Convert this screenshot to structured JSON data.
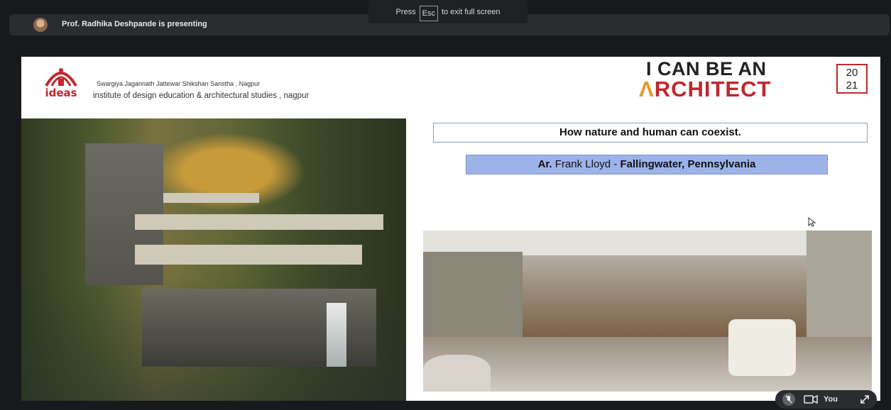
{
  "presenter_bar": {
    "text": "Prof. Radhika Deshpande is presenting"
  },
  "fullscreen_toast": {
    "before": "Press",
    "key": "Esc",
    "after": "to exit full screen"
  },
  "slide": {
    "logo_word": "ideas",
    "institute_line1": "Swargiya Jagannath Jattewar Shikshan Sanstha , Nagpur",
    "institute_line2": "institute of design education & architectural studies , nagpur",
    "campaign_line1": "I CAN BE AN",
    "campaign_line2_mark": "Λ",
    "campaign_line2_rest": "RCHITECT",
    "year_top": "20",
    "year_bottom": "21",
    "headline": "How nature and human can coexist.",
    "credit_prefix": "Ar.",
    "credit_name": " Frank Lloyd - ",
    "credit_work": "Fallingwater, Pennsylvania"
  },
  "self_view": {
    "label": "You"
  },
  "colors": {
    "accent_red": "#c1272d",
    "accent_orange": "#e39a2a",
    "credit_fill": "#9db3e8"
  }
}
